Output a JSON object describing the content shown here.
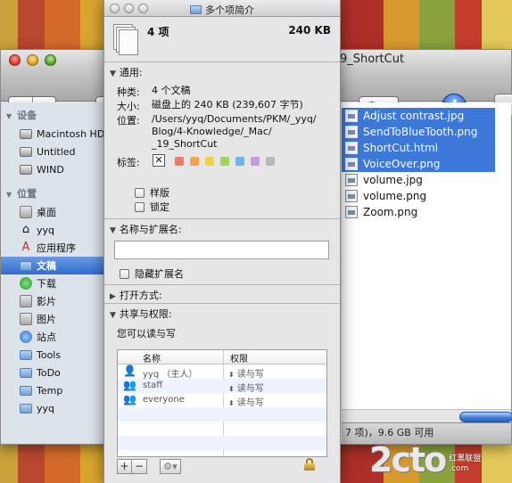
{
  "finder": {
    "title": "9_ShortCut",
    "status_text": "7 项)，9.6 GB 可用",
    "sidebar": {
      "devices_heading": "设备",
      "devices": [
        {
          "label": "Macintosh HD",
          "icon": "hard-disk-icon"
        },
        {
          "label": "Untitled",
          "icon": "disk-icon"
        },
        {
          "label": "WIND",
          "icon": "disk-icon"
        }
      ],
      "places_heading": "位置",
      "places": [
        {
          "label": "桌面",
          "icon": "desktop-icon"
        },
        {
          "label": "yyq",
          "icon": "home-icon"
        },
        {
          "label": "应用程序",
          "icon": "applications-icon"
        },
        {
          "label": "文稿",
          "icon": "documents-icon"
        },
        {
          "label": "下载",
          "icon": "downloads-icon"
        },
        {
          "label": "影片",
          "icon": "movies-icon"
        },
        {
          "label": "图片",
          "icon": "pictures-icon"
        },
        {
          "label": "站点",
          "icon": "sites-icon"
        },
        {
          "label": "Tools",
          "icon": "folder-icon"
        },
        {
          "label": "ToDo",
          "icon": "folder-icon"
        },
        {
          "label": "Temp",
          "icon": "folder-icon"
        },
        {
          "label": "yyq",
          "icon": "folder-icon"
        }
      ]
    },
    "files": [
      {
        "name": "Adjust contrast.jpg",
        "selected": true
      },
      {
        "name": "SendToBlueTooth.png",
        "selected": true
      },
      {
        "name": "ShortCut.html",
        "selected": true
      },
      {
        "name": "VoiceOver.png",
        "selected": true
      },
      {
        "name": "volume.jpg",
        "selected": false
      },
      {
        "name": "volume.png",
        "selected": false
      },
      {
        "name": "Zoom.png",
        "selected": false
      }
    ],
    "action_glyph": "⚙",
    "info_glyph": "i"
  },
  "info": {
    "title": "多个项简介",
    "count": "4 项",
    "size": "240 KB",
    "general": {
      "heading": "通用:",
      "kind_label": "种类:",
      "kind_value": "4 个文稿",
      "size_label": "大小:",
      "size_value": "磁盘上的 240 KB (239,607 字节)",
      "where_label": "位置:",
      "where_value": "/Users/yyq/Documents/PKM/_yyq/Blog/4-Knowledge/_Mac/_19_ShortCut",
      "where_lines": [
        "/Users/yyq/Documents/PKM/_yyq/",
        "Blog/4-Knowledge/_Mac/",
        "_19_ShortCut"
      ],
      "tags_label": "标签:",
      "tag_none": "✕",
      "tag_colors": [
        "#f07a6a",
        "#f5a24a",
        "#f2d14a",
        "#9ed65a",
        "#6fb3f0",
        "#c79ae0",
        "#b9b9b9"
      ],
      "stationery_label": "样版",
      "locked_label": "锁定"
    },
    "name_ext": {
      "heading": "名称与扩展名:",
      "name_value": "",
      "hide_ext_label": "隐藏扩展名"
    },
    "open_with": {
      "heading": "打开方式:"
    },
    "sharing": {
      "heading": "共享与权限:",
      "note": "您可以读与写",
      "col_name": "名称",
      "col_priv": "权限",
      "rows": [
        {
          "name": "yyq （主人）",
          "priv": "读与写"
        },
        {
          "name": "staff",
          "priv": "读与写"
        },
        {
          "name": "everyone",
          "priv": "读与写"
        }
      ],
      "add_label": "+",
      "remove_label": "−",
      "gear_label": "⚙▾"
    }
  },
  "watermark": {
    "logo": "2cto",
    "side_text_1": "红黑联盟",
    "side_text_2": ".com"
  }
}
